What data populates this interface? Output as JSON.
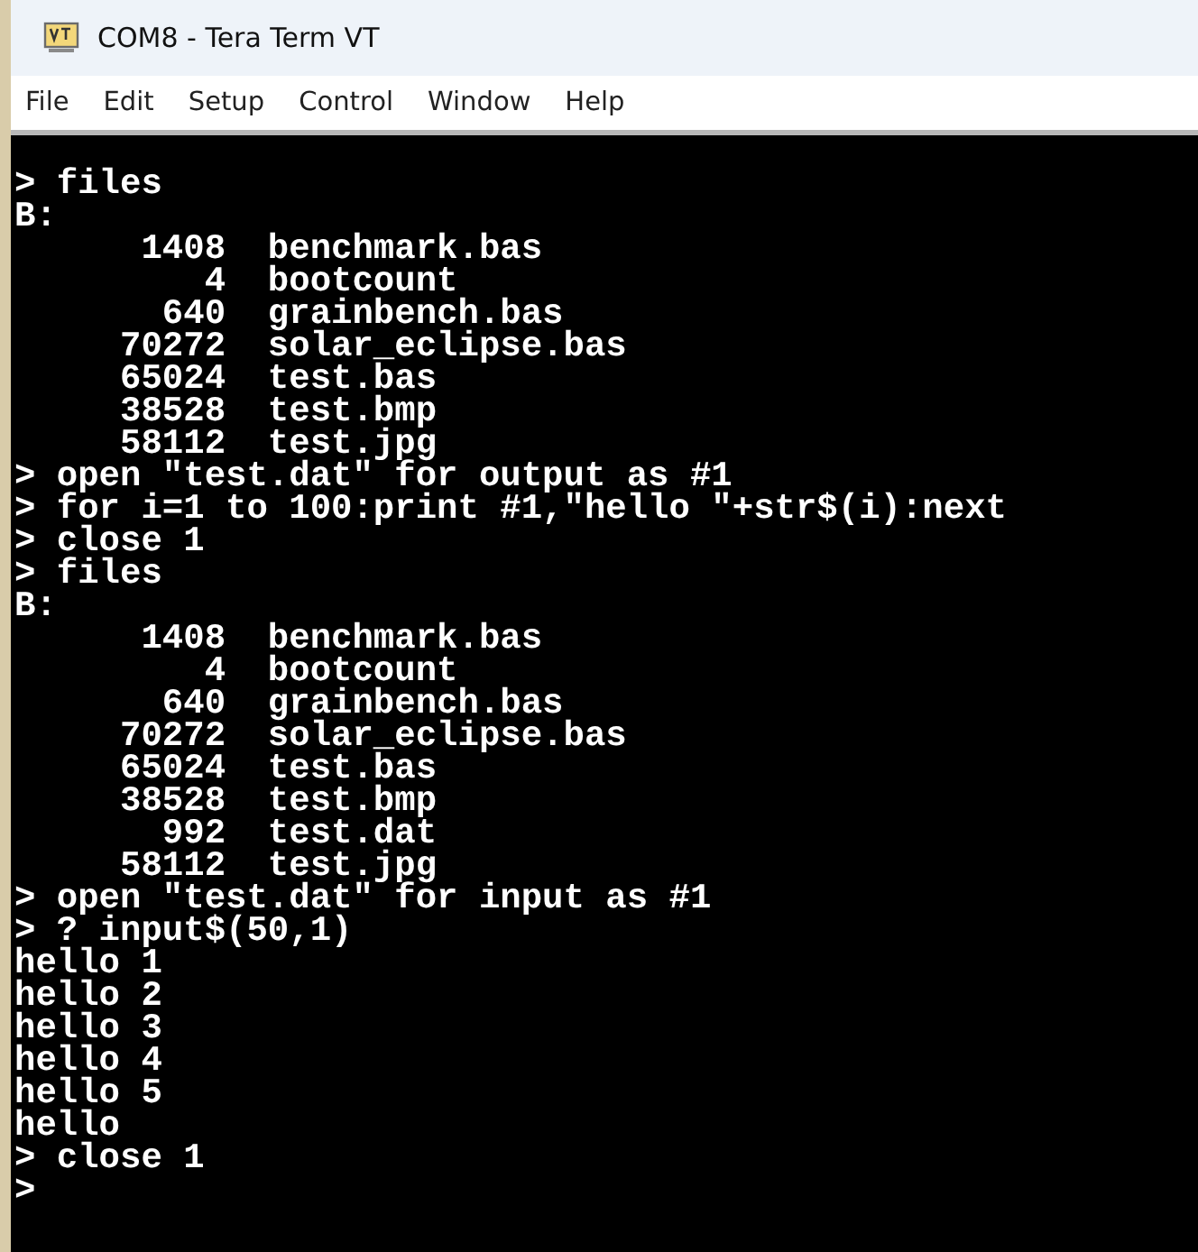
{
  "window": {
    "title": "COM8 - Tera Term VT"
  },
  "menu": [
    "File",
    "Edit",
    "Setup",
    "Control",
    "Window",
    "Help"
  ],
  "terminal": {
    "lines": [
      "> files",
      "B:",
      "      1408  benchmark.bas",
      "         4  bootcount",
      "       640  grainbench.bas",
      "     70272  solar_eclipse.bas",
      "     65024  test.bas",
      "     38528  test.bmp",
      "     58112  test.jpg",
      "> open \"test.dat\" for output as #1",
      "> for i=1 to 100:print #1,\"hello \"+str$(i):next",
      "> close 1",
      "> files",
      "B:",
      "      1408  benchmark.bas",
      "         4  bootcount",
      "       640  grainbench.bas",
      "     70272  solar_eclipse.bas",
      "     65024  test.bas",
      "     38528  test.bmp",
      "       992  test.dat",
      "     58112  test.jpg",
      "> open \"test.dat\" for input as #1",
      "> ? input$(50,1)",
      "hello 1",
      "hello 2",
      "hello 3",
      "hello 4",
      "hello 5",
      "hello",
      "> close 1",
      ">"
    ]
  }
}
